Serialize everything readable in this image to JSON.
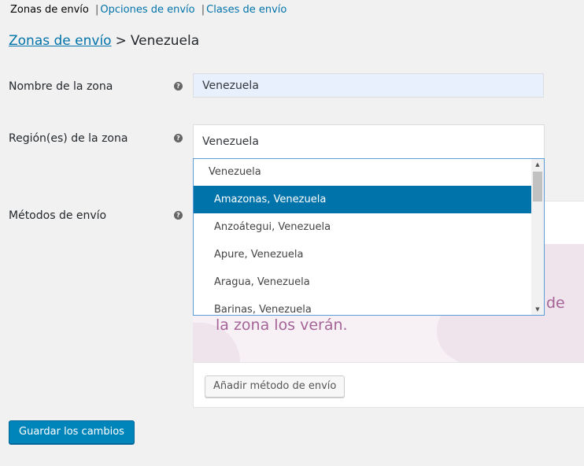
{
  "subnav": {
    "current": "Zonas de envío",
    "links": [
      "Opciones de envío",
      "Clases de envío"
    ],
    "separator": "|"
  },
  "breadcrumb": {
    "link": "Zonas de envío",
    "separator": ">",
    "current": "Venezuela"
  },
  "form": {
    "zone_name_label": "Nombre de la zona",
    "zone_name_value": "Venezuela",
    "regions_label": "Región(es) de la zona",
    "regions_value": "Venezuela",
    "methods_label": "Métodos de envío",
    "help_glyph": "?"
  },
  "dropdown": {
    "search_value": "Venezuela",
    "options": [
      {
        "label": "Amazonas, Venezuela",
        "selected": true
      },
      {
        "label": "Anzoátegui, Venezuela",
        "selected": false
      },
      {
        "label": "Apure, Venezuela",
        "selected": false
      },
      {
        "label": "Aragua, Venezuela",
        "selected": false
      },
      {
        "label": "Barinas, Venezuela",
        "selected": false
      }
    ]
  },
  "methods": {
    "blank_text_line2": "la zona los verán.",
    "blank_text_fragment": "de",
    "add_button": "Añadir método de envío"
  },
  "save_button": "Guardar los cambios",
  "colors": {
    "accent": "#0073aa",
    "primary_button": "#0085ba",
    "woo_purple": "#a46497"
  }
}
